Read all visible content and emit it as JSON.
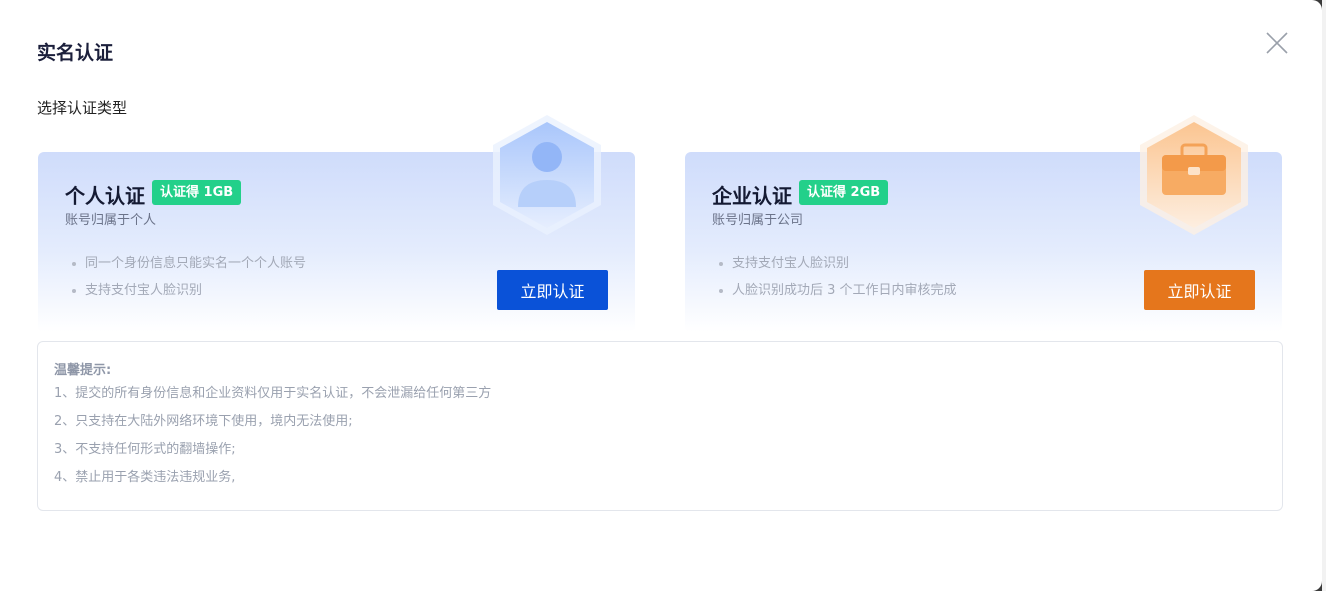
{
  "modal": {
    "title": "实名认证",
    "subtitle": "选择认证类型",
    "close_icon": "close-icon"
  },
  "cards": {
    "personal": {
      "title": "个人认证",
      "badge": "认证得 1GB",
      "desc": "账号归属于个人",
      "features": [
        "同一个身份信息只能实名一个个人账号",
        "支持支付宝人脸识别"
      ],
      "button": "立即认证",
      "icon": "user-icon",
      "accent": "#0a52d8"
    },
    "company": {
      "title": "企业认证",
      "badge": "认证得 2GB",
      "desc": "账号归属于公司",
      "features": [
        "支持支付宝人脸识别",
        "人脸识别成功后 3 个工作日内审核完成"
      ],
      "button": "立即认证",
      "icon": "briefcase-icon",
      "accent": "#e5761c"
    }
  },
  "tips": {
    "title": "温馨提示:",
    "items": [
      "1、提交的所有身份信息和企业资料仅用于实名认证，不会泄漏给任何第三方",
      "2、只支持在大陆外网络环境下使用，境内无法使用;",
      "3、不支持任何形式的翻墙操作;",
      "4、禁止用于各类违法违规业务,"
    ]
  }
}
